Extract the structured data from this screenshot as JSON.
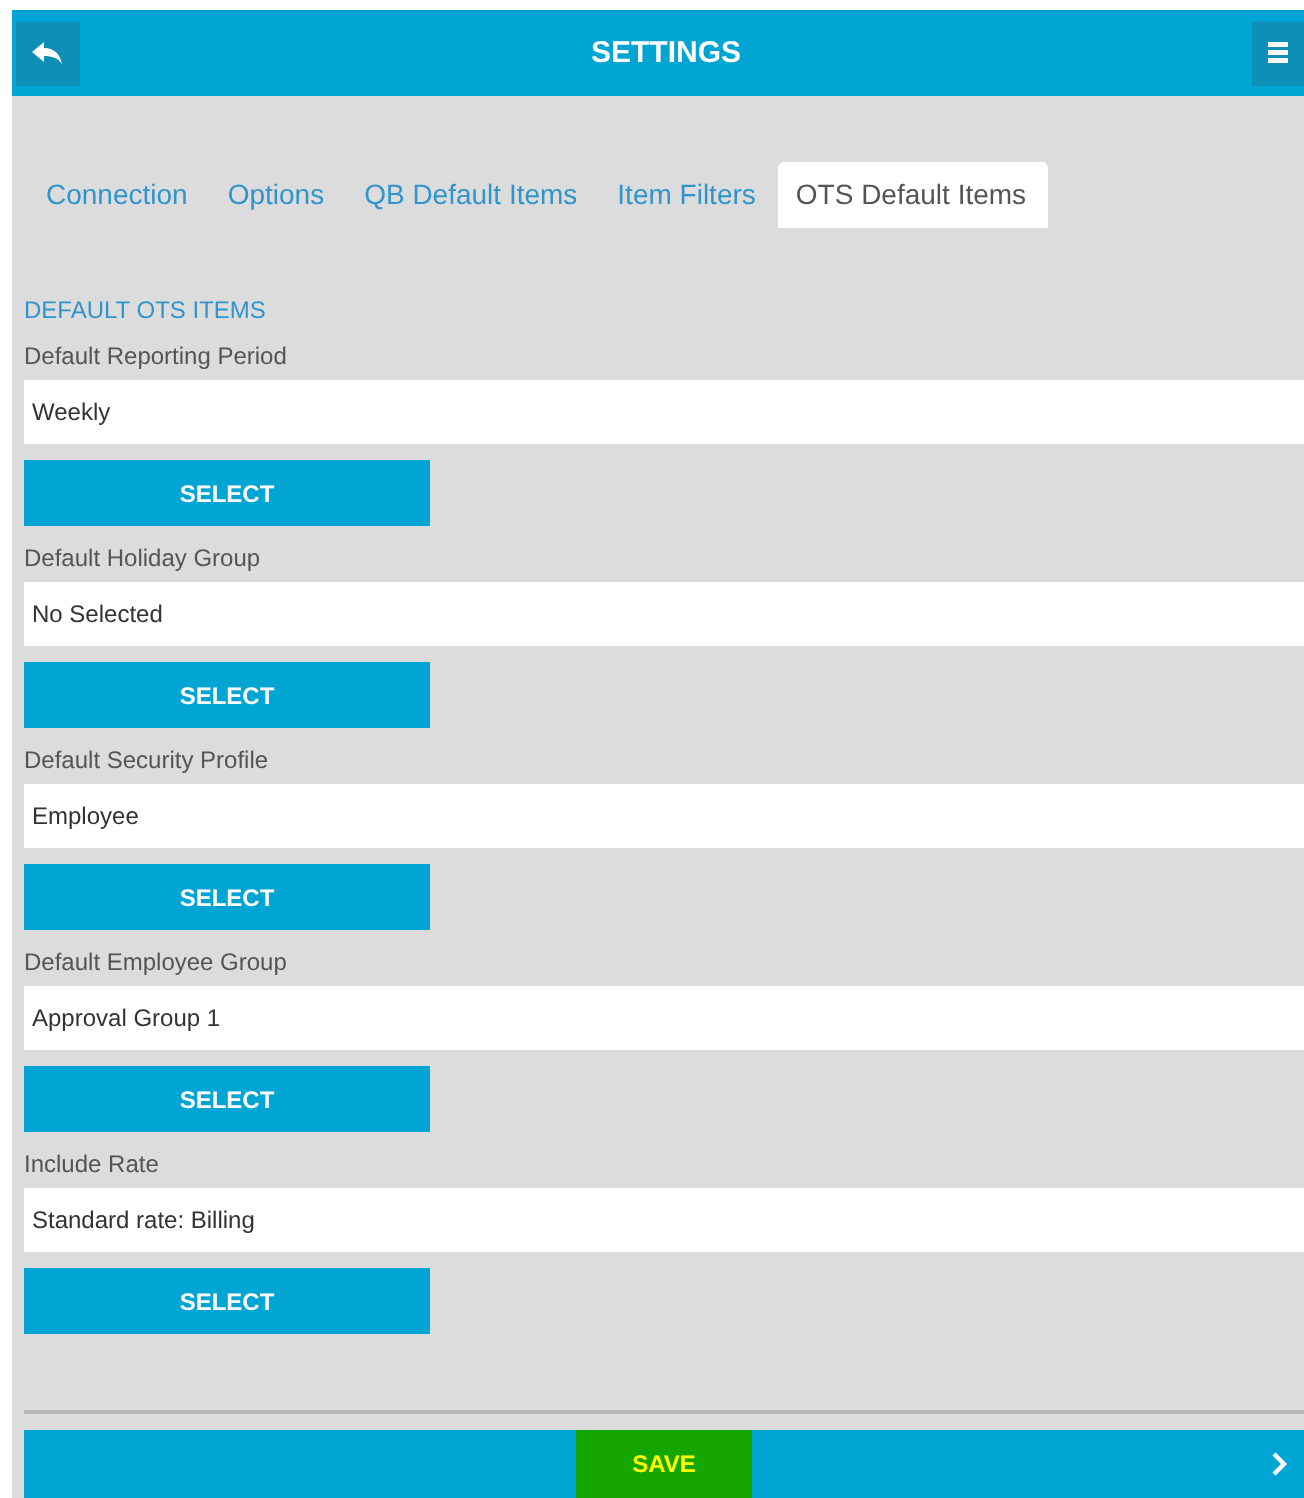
{
  "header": {
    "title": "SETTINGS"
  },
  "tabs": [
    {
      "label": "Connection",
      "selected": false
    },
    {
      "label": "Options",
      "selected": false
    },
    {
      "label": "QB Default Items",
      "selected": false
    },
    {
      "label": "Item Filters",
      "selected": false
    },
    {
      "label": "OTS Default Items",
      "selected": true
    }
  ],
  "section": {
    "title": "DEFAULT OTS ITEMS"
  },
  "fields": [
    {
      "label": "Default Reporting Period",
      "value": "Weekly",
      "button": "SELECT"
    },
    {
      "label": "Default Holiday Group",
      "value": "No Selected",
      "button": "SELECT"
    },
    {
      "label": "Default Security Profile",
      "value": "Employee",
      "button": "SELECT"
    },
    {
      "label": "Default Employee Group",
      "value": "Approval Group 1",
      "button": "SELECT"
    },
    {
      "label": "Include Rate",
      "value": "Standard rate: Billing",
      "button": "SELECT"
    }
  ],
  "save_bar": {
    "label": "SAVE",
    "highlighted": true
  }
}
